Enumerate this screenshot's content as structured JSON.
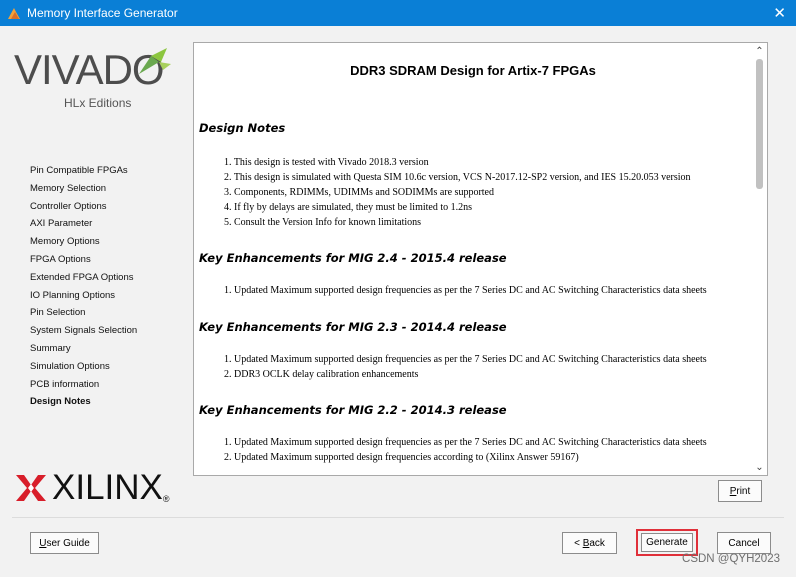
{
  "window": {
    "title": "Memory Interface Generator",
    "close_glyph": "✕"
  },
  "brand": {
    "vivado": "VIVADO",
    "edition": "HLx Editions",
    "xilinx": "XILINX",
    "registered": "®",
    "accent_color": "#8cc63f"
  },
  "nav": {
    "items": [
      {
        "label": "Pin Compatible FPGAs"
      },
      {
        "label": "Memory Selection"
      },
      {
        "label": "Controller Options"
      },
      {
        "label": "AXI Parameter"
      },
      {
        "label": "Memory Options"
      },
      {
        "label": "FPGA Options"
      },
      {
        "label": "Extended FPGA Options"
      },
      {
        "label": "IO Planning Options"
      },
      {
        "label": "Pin Selection"
      },
      {
        "label": "System Signals Selection"
      },
      {
        "label": "Summary"
      },
      {
        "label": "Simulation Options"
      },
      {
        "label": "PCB information"
      },
      {
        "label": "Design Notes"
      }
    ],
    "active": "Design Notes"
  },
  "doc": {
    "title": "DDR3 SDRAM Design for Artix-7 FPGAs",
    "notes_heading": "Design Notes",
    "notes": [
      "1. This design is tested with Vivado 2018.3 version",
      "2. This design is simulated with Questa SIM 10.6c version, VCS N-2017.12-SP2 version, and IES 15.20.053 version",
      "3. Components, RDIMMs, UDIMMs and SODIMMs are supported",
      "4. If fly by delays are simulated, they must be limited to 1.2ns",
      "5. Consult the Version Info for known limitations"
    ],
    "sections": [
      {
        "heading": "Key Enhancements for MIG 2.4 - 2015.4 release",
        "items": [
          "1. Updated Maximum supported design frequencies as per the 7 Series DC and AC Switching Characteristics data sheets"
        ]
      },
      {
        "heading": "Key Enhancements for MIG 2.3 - 2014.4 release",
        "items": [
          "1. Updated Maximum supported design frequencies as per the 7 Series DC and AC Switching Characteristics data sheets",
          "2. DDR3 OCLK delay calibration enhancements"
        ]
      },
      {
        "heading": "Key Enhancements for MIG 2.2 - 2014.3 release",
        "items": [
          "1. Updated Maximum supported design frequencies as per the 7 Series DC and AC Switching Characteristics data sheets",
          "2. Updated Maximum supported design frequencies according to (Xilinx Answer 59167)"
        ]
      }
    ]
  },
  "buttons": {
    "print": {
      "accel": "P",
      "rest": "rint"
    },
    "user_guide": {
      "accel": "U",
      "rest": "ser Guide"
    },
    "back": {
      "prefix": "< ",
      "accel": "B",
      "rest": "ack"
    },
    "generate": "Generate",
    "cancel": "Cancel"
  },
  "watermark": "CSDN @QYH2023",
  "highlight_color": "#e0303a",
  "titlebar_color": "#0a7fd6"
}
